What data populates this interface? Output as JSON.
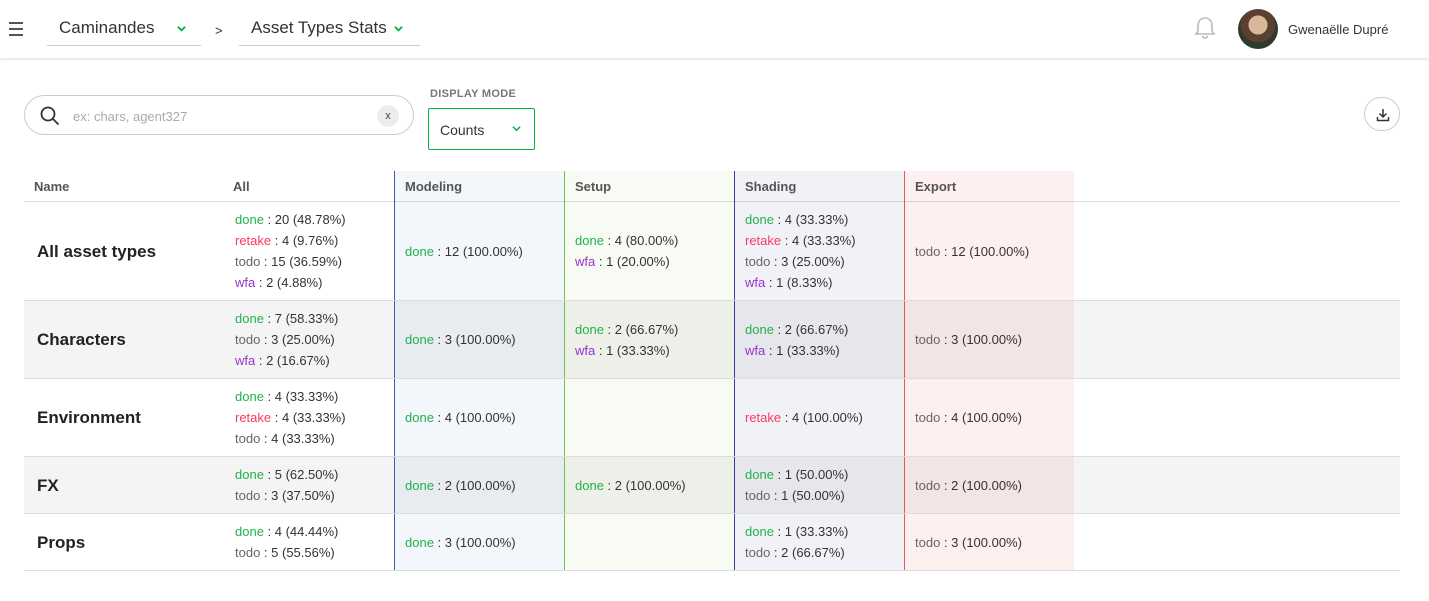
{
  "topbar": {
    "production": "Caminandes",
    "separator": ">",
    "section": "Asset Types Stats",
    "user_name": "Gwenaëlle Dupré"
  },
  "filters": {
    "search_placeholder": "ex: chars, agent327",
    "clear_label": "x",
    "display_mode_label": "DISPLAY MODE",
    "display_mode_value": "Counts"
  },
  "columns": {
    "name": "Name",
    "all": "All",
    "tasks": [
      "Modeling",
      "Setup",
      "Shading",
      "Export"
    ]
  },
  "colors": {
    "done": "#22b14c",
    "retake": "#ff3860",
    "todo": "#666666",
    "wfa": "#9933cc",
    "modeling": "#3860a8",
    "setup": "#6fc34a",
    "shading": "#3340a0",
    "export": "#e05858",
    "accent": "#00b242"
  },
  "rows": [
    {
      "name": "All asset types",
      "all": [
        {
          "status": "done",
          "value": " : 20 (48.78%)"
        },
        {
          "status": "retake",
          "value": " : 4 (9.76%)"
        },
        {
          "status": "todo",
          "value": " : 15 (36.59%)"
        },
        {
          "status": "wfa",
          "value": " : 2 (4.88%)"
        }
      ],
      "tasks": [
        [
          {
            "status": "done",
            "value": " : 12 (100.00%)"
          }
        ],
        [
          {
            "status": "done",
            "value": " : 4 (80.00%)"
          },
          {
            "status": "wfa",
            "value": " : 1 (20.00%)"
          }
        ],
        [
          {
            "status": "done",
            "value": " : 4 (33.33%)"
          },
          {
            "status": "retake",
            "value": " : 4 (33.33%)"
          },
          {
            "status": "todo",
            "value": " : 3 (25.00%)"
          },
          {
            "status": "wfa",
            "value": " : 1 (8.33%)"
          }
        ],
        [
          {
            "status": "todo",
            "value": " : 12 (100.00%)"
          }
        ]
      ]
    },
    {
      "name": "Characters",
      "all": [
        {
          "status": "done",
          "value": " : 7 (58.33%)"
        },
        {
          "status": "todo",
          "value": " : 3 (25.00%)"
        },
        {
          "status": "wfa",
          "value": " : 2 (16.67%)"
        }
      ],
      "tasks": [
        [
          {
            "status": "done",
            "value": " : 3 (100.00%)"
          }
        ],
        [
          {
            "status": "done",
            "value": " : 2 (66.67%)"
          },
          {
            "status": "wfa",
            "value": " : 1 (33.33%)"
          }
        ],
        [
          {
            "status": "done",
            "value": " : 2 (66.67%)"
          },
          {
            "status": "wfa",
            "value": " : 1 (33.33%)"
          }
        ],
        [
          {
            "status": "todo",
            "value": " : 3 (100.00%)"
          }
        ]
      ]
    },
    {
      "name": "Environment",
      "all": [
        {
          "status": "done",
          "value": " : 4 (33.33%)"
        },
        {
          "status": "retake",
          "value": " : 4 (33.33%)"
        },
        {
          "status": "todo",
          "value": " : 4 (33.33%)"
        }
      ],
      "tasks": [
        [
          {
            "status": "done",
            "value": " : 4 (100.00%)"
          }
        ],
        [],
        [
          {
            "status": "retake",
            "value": " : 4 (100.00%)"
          }
        ],
        [
          {
            "status": "todo",
            "value": " : 4 (100.00%)"
          }
        ]
      ]
    },
    {
      "name": "FX",
      "all": [
        {
          "status": "done",
          "value": " : 5 (62.50%)"
        },
        {
          "status": "todo",
          "value": " : 3 (37.50%)"
        }
      ],
      "tasks": [
        [
          {
            "status": "done",
            "value": " : 2 (100.00%)"
          }
        ],
        [
          {
            "status": "done",
            "value": " : 2 (100.00%)"
          }
        ],
        [
          {
            "status": "done",
            "value": " : 1 (50.00%)"
          },
          {
            "status": "todo",
            "value": " : 1 (50.00%)"
          }
        ],
        [
          {
            "status": "todo",
            "value": " : 2 (100.00%)"
          }
        ]
      ]
    },
    {
      "name": "Props",
      "all": [
        {
          "status": "done",
          "value": " : 4 (44.44%)"
        },
        {
          "status": "todo",
          "value": " : 5 (55.56%)"
        }
      ],
      "tasks": [
        [
          {
            "status": "done",
            "value": " : 3 (100.00%)"
          }
        ],
        [],
        [
          {
            "status": "done",
            "value": " : 1 (33.33%)"
          },
          {
            "status": "todo",
            "value": " : 2 (66.67%)"
          }
        ],
        [
          {
            "status": "todo",
            "value": " : 3 (100.00%)"
          }
        ]
      ]
    }
  ]
}
